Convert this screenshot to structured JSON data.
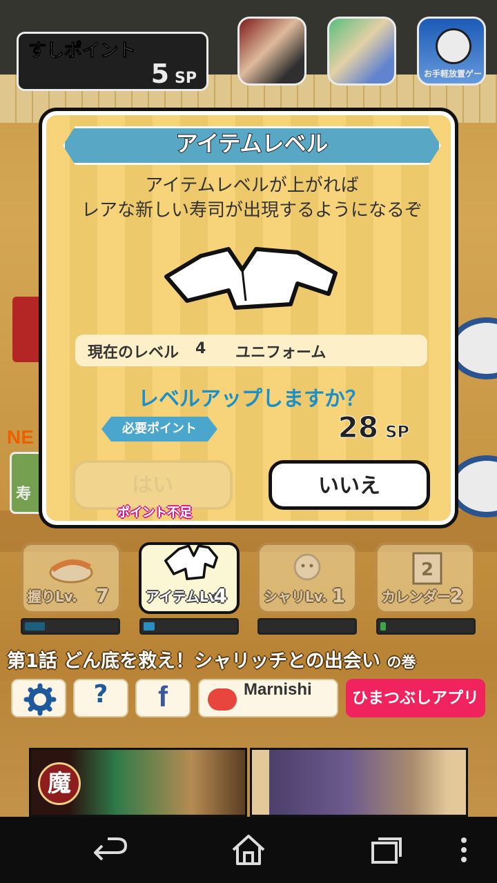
{
  "header": {
    "points_label": "すしポイント",
    "points_value": "5",
    "points_unit": "SP",
    "promo_apps": [
      {
        "icon": "app-promo-1-icon"
      },
      {
        "icon": "app-promo-2-icon"
      },
      {
        "icon": "app-promo-3-icon",
        "label": "お手軽放置ゲー"
      }
    ]
  },
  "dialog": {
    "title": "アイテムレベル",
    "description_line1": "アイテムレベルが上がれば",
    "description_line2": "レアな新しい寿司が出現するようになるぞ",
    "item_icon": "uniform-icon",
    "current_level_label": "現在のレベル",
    "current_level_value": "4",
    "item_name": "ユニフォーム",
    "question": "レベルアップしますか？",
    "required_points_label": "必要ポイント",
    "required_points_value": "28",
    "required_points_unit": "SP",
    "yes_label": "はい",
    "no_label": "いいえ",
    "insufficient_label": "ポイント不足"
  },
  "stats": [
    {
      "label": "握りLv.",
      "value": "7",
      "progress": 0.22
    },
    {
      "label": "アイテムLv.",
      "value": "4",
      "progress": 0.12
    },
    {
      "label": "シャリLv.",
      "value": "1",
      "progress": 0.0
    },
    {
      "label": "カレンダー",
      "value": "2",
      "progress": 0.06
    }
  ],
  "stat_colors": {
    "bar_fill": "#2a8fc0",
    "bar_fill_green": "#3aa845",
    "bar_fill_dim": "#1b5f7d"
  },
  "episode": {
    "text": "第1話 どん底を救え！シャリッチとの出会い",
    "suffix": "の巻"
  },
  "bottom_buttons": {
    "settings_icon": "gear-icon",
    "help_label": "?",
    "facebook_label": "f",
    "marnishi_label": "Marnishi",
    "himatsubushi_label": "ひまつぶしアプリ"
  },
  "ads": {
    "ad1_seal": "魔"
  },
  "navbar": {
    "back": "back-icon",
    "home": "home-icon",
    "recents": "recents-icon",
    "menu": "menu-icon"
  },
  "colors": {
    "accent_blue": "#1a8fc8",
    "title_bar": "#58a7c5",
    "himatsubushi": "#f0235f",
    "dialog_bg": "#f6cf6e"
  }
}
